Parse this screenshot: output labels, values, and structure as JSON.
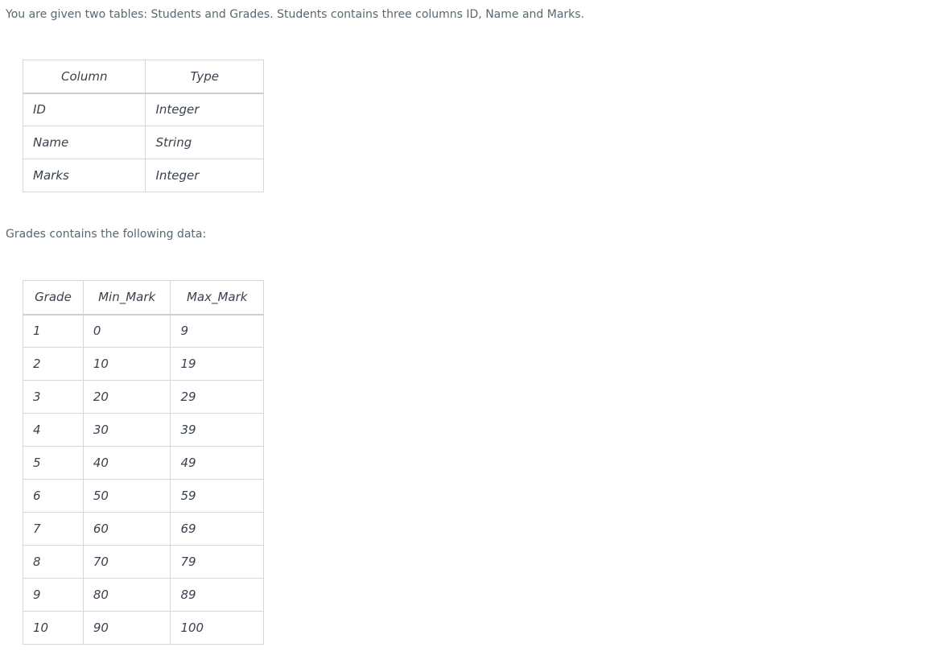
{
  "intro_text": "You are given two tables: Students and Grades. Students contains three columns ID, Name and Marks.",
  "students_schema": {
    "headers": [
      "Column",
      "Type"
    ],
    "rows": [
      [
        "ID",
        "Integer"
      ],
      [
        "Name",
        "String"
      ],
      [
        "Marks",
        "Integer"
      ]
    ]
  },
  "grades_intro_text": "Grades contains the following data:",
  "grades_table": {
    "headers": [
      "Grade",
      "Min_Mark",
      "Max_Mark"
    ],
    "rows": [
      [
        "1",
        "0",
        "9"
      ],
      [
        "2",
        "10",
        "19"
      ],
      [
        "3",
        "20",
        "29"
      ],
      [
        "4",
        "30",
        "39"
      ],
      [
        "5",
        "40",
        "49"
      ],
      [
        "6",
        "50",
        "59"
      ],
      [
        "7",
        "60",
        "69"
      ],
      [
        "8",
        "70",
        "79"
      ],
      [
        "9",
        "80",
        "89"
      ],
      [
        "10",
        "90",
        "100"
      ]
    ]
  }
}
